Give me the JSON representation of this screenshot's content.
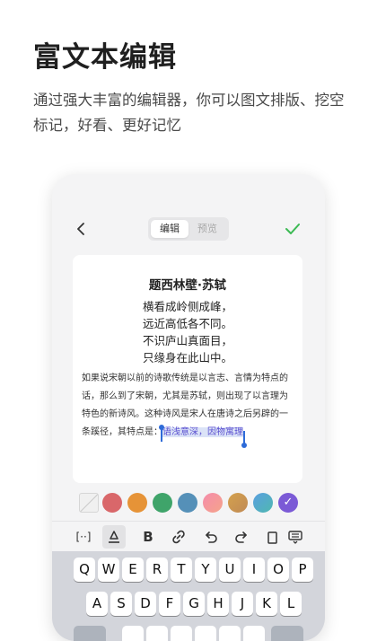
{
  "promo": {
    "title": "富文本编辑",
    "description": "通过强大丰富的编辑器，你可以图文排版、挖空标记，好看、更好记忆"
  },
  "editor": {
    "tabs": [
      {
        "label": "编辑",
        "active": true
      },
      {
        "label": "预览",
        "active": false
      }
    ],
    "check_color": "#3cba54"
  },
  "document": {
    "poem_title": "题西林壁·苏轼",
    "poem_lines": [
      "横看成岭侧成峰，",
      "远近高低各不同。",
      "不识庐山真面目，",
      "只缘身在此山中。"
    ],
    "body_text": "如果说宋朝以前的诗歌传统是以言志、言情为特点的话，那么到了宋朝，尤其是苏轼，则出现了以言理为特色的新诗风。这种诗风是宋人在唐诗之后另辟的一条蹊径，其特点是：",
    "highlighted_text": "语浅意深，因物寓理"
  },
  "palette": {
    "swatches": [
      {
        "name": "no-color",
        "color": "#f0f0f0"
      },
      {
        "name": "red",
        "color": "#d9676a"
      },
      {
        "name": "orange",
        "color": "#e69337"
      },
      {
        "name": "green",
        "color": "#3fa46a"
      },
      {
        "name": "blue",
        "color": "#5590b8"
      },
      {
        "name": "pink",
        "color": "linear-gradient(135deg,#f58cab,#f5a38a)"
      },
      {
        "name": "gold",
        "color": "linear-gradient(135deg,#d4a14d,#c08a55)"
      },
      {
        "name": "teal-blue",
        "color": "linear-gradient(135deg,#5a9fe0,#4fb8b0)"
      },
      {
        "name": "purple",
        "color": "#7b5ad6",
        "selected": true
      }
    ]
  },
  "toolbar": {
    "tools": [
      {
        "name": "blank-fill-icon",
        "glyph": "[··]"
      },
      {
        "name": "highlight-icon",
        "glyph": "",
        "active": true
      },
      {
        "name": "bold-icon",
        "glyph": "B"
      },
      {
        "name": "link-icon",
        "glyph": ""
      },
      {
        "name": "undo-icon",
        "glyph": ""
      },
      {
        "name": "redo-icon",
        "glyph": ""
      },
      {
        "name": "clear-icon",
        "glyph": ""
      },
      {
        "name": "keyboard-hide-icon",
        "glyph": ""
      }
    ]
  },
  "keyboard": {
    "row1": [
      "Q",
      "W",
      "E",
      "R",
      "T",
      "Y",
      "U",
      "I",
      "O",
      "P"
    ],
    "row2": [
      "A",
      "S",
      "D",
      "F",
      "G",
      "H",
      "J",
      "K",
      "L"
    ]
  }
}
